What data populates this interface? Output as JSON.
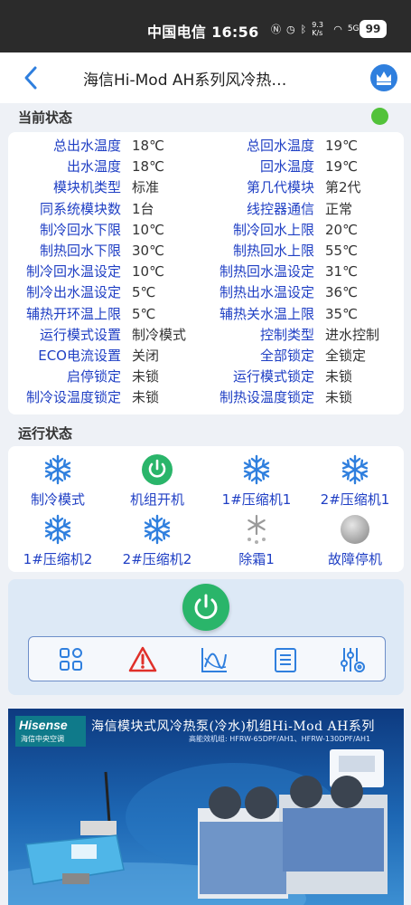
{
  "status_bar": {
    "carrier_time": "中国电信 16:56",
    "net_speed": "9.3 K/s",
    "signal": "5G",
    "battery": "99"
  },
  "header": {
    "title": "海信Hi-Mod AH系列风冷热…",
    "back_icon": "chevron-left-icon",
    "crown_icon": "crown-icon"
  },
  "current_status": {
    "title": "当前状态",
    "online_color": "#52c23a",
    "params": [
      {
        "label": "总出水温度",
        "value": "18℃"
      },
      {
        "label": "总回水温度",
        "value": "19℃"
      },
      {
        "label": "出水温度",
        "value": "18℃"
      },
      {
        "label": "回水温度",
        "value": "19℃"
      },
      {
        "label": "模块机类型",
        "value": "标准"
      },
      {
        "label": "第几代模块",
        "value": "第2代"
      },
      {
        "label": "同系统模块数",
        "value": "1台"
      },
      {
        "label": "线控器通信",
        "value": "正常"
      },
      {
        "label": "制冷回水下限",
        "value": "10℃"
      },
      {
        "label": "制冷回水上限",
        "value": "20℃"
      },
      {
        "label": "制热回水下限",
        "value": "30℃"
      },
      {
        "label": "制热回水上限",
        "value": "55℃"
      },
      {
        "label": "制冷回水温设定",
        "value": "10℃"
      },
      {
        "label": "制热回水温设定",
        "value": "31℃"
      },
      {
        "label": "制冷出水温设定",
        "value": "5℃"
      },
      {
        "label": "制热出水温设定",
        "value": "36℃"
      },
      {
        "label": "辅热开环温上限",
        "value": "5℃"
      },
      {
        "label": "辅热关水温上限",
        "value": "35℃"
      },
      {
        "label": "运行模式设置",
        "value": "制冷模式"
      },
      {
        "label": "控制类型",
        "value": "进水控制"
      },
      {
        "label": "ECO电流设置",
        "value": "关闭"
      },
      {
        "label": "全部锁定",
        "value": "全锁定"
      },
      {
        "label": "启停锁定",
        "value": "未锁"
      },
      {
        "label": "运行模式锁定",
        "value": "未锁"
      },
      {
        "label": "制冷设温度锁定",
        "value": "未锁"
      },
      {
        "label": "制热设温度锁定",
        "value": "未锁"
      }
    ]
  },
  "run_status": {
    "title": "运行状态",
    "items": [
      {
        "label": "制冷模式",
        "icon": "snowflake-icon"
      },
      {
        "label": "机组开机",
        "icon": "power-on-icon"
      },
      {
        "label": "1#压缩机1",
        "icon": "snowflake-icon"
      },
      {
        "label": "2#压缩机1",
        "icon": "snowflake-icon"
      },
      {
        "label": "1#压缩机2",
        "icon": "snowflake-icon"
      },
      {
        "label": "2#压缩机2",
        "icon": "snowflake-icon"
      },
      {
        "label": "除霜1",
        "icon": "defrost-icon"
      },
      {
        "label": "故障停机",
        "icon": "fault-indicator-icon"
      }
    ]
  },
  "controls": {
    "power_icon": "power-icon",
    "tools": [
      "grid-icon",
      "alarm-icon",
      "chart-icon",
      "list-icon",
      "settings-sliders-icon"
    ]
  },
  "banner": {
    "brand": "Hisense",
    "brand_sub": "海信中央空调",
    "title": "海信模块式风冷热泵(冷水)机组Hi-Mod AH系列",
    "subtitle": "高能效机组: HFRW-65DPF/AH1、HFRW-130DPF/AH1"
  },
  "colors": {
    "accent_blue": "#1f3fc4",
    "icon_blue": "#2f7fde",
    "power_green": "#2ab56a",
    "alarm_red": "#e0302a"
  }
}
